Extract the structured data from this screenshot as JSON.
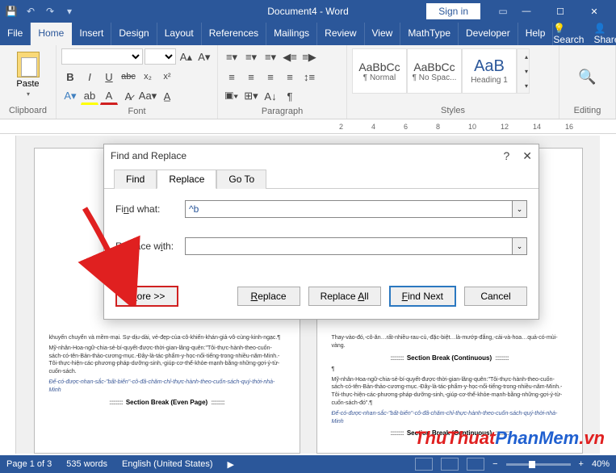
{
  "titlebar": {
    "doc_title": "Document4 - Word",
    "signin": "Sign in"
  },
  "tabs": {
    "file": "File",
    "home": "Home",
    "insert": "Insert",
    "design": "Design",
    "layout": "Layout",
    "references": "References",
    "mailings": "Mailings",
    "review": "Review",
    "view": "View",
    "mathtype": "MathType",
    "developer": "Developer",
    "help": "Help",
    "search": "Search",
    "share": "Share"
  },
  "ribbon": {
    "clipboard": {
      "paste": "Paste",
      "label": "Clipboard"
    },
    "font": {
      "label": "Font",
      "bold": "B",
      "italic": "I",
      "underline": "U",
      "strike": "abc",
      "sub": "x₂",
      "sup": "x²"
    },
    "paragraph": {
      "label": "Paragraph"
    },
    "styles": {
      "label": "Styles",
      "items": [
        {
          "preview": "AaBbCc",
          "name": "¶ Normal"
        },
        {
          "preview": "AaBbCc",
          "name": "¶ No Spac..."
        },
        {
          "preview": "AaB",
          "name": "Heading 1"
        }
      ]
    },
    "editing": {
      "label": "Editing"
    }
  },
  "ruler": {
    "marks": [
      "2",
      "4",
      "6",
      "8",
      "10",
      "12",
      "14",
      "16"
    ]
  },
  "dialog": {
    "title": "Find and Replace",
    "tabs": {
      "find": "Find",
      "replace": "Replace",
      "goto": "Go To"
    },
    "find_label": "Find what:",
    "find_value": "^b",
    "replace_label": "Replace with:",
    "replace_value": "",
    "buttons": {
      "more": "More >>",
      "replace": "Replace",
      "replace_all": "Replace All",
      "find_next": "Find Next",
      "cancel": "Cancel"
    }
  },
  "document": {
    "page1": {
      "line1": "khuyến chuyển và mềm-mại. Sự-dịu-dài, vẻ-đẹp-của-cô-khiến-khán-giả-vô-cùng-kinh-ngạc.¶",
      "line2": "Mỹ-nhân-Hoa-ngữ-chia-sẻ-bí-quyết-được-thời-gian-lãng-quên:\"Tôi-thực-hành-theo-cuốn-sách-có-tên-Bản-thảo-cương-mục.-Đây-là-tác-phẩm-y-học-nổi-tiếng-trong-nhiều-năm-Minh.-Tôi-thực-hiện-các-phương-pháp-dưỡng-sinh,-giúp-cơ-thể-khỏe-mạnh-bằng-những-gợi-ý-từ-cuốn-sách.",
      "line3": "Để-có-được-nhan-sắc-\"bất-biến\"-cô-đã-chăm-chỉ-thực-hành-theo-cuốn-sách-quý-thời-nhà-Minh",
      "break1": "Section Break (Even Page)"
    },
    "page2": {
      "line1": "Thay-vào-đó,-cô-ăn…rất-nhiều-rau-củ,-đặc-biệt…là-mướp-đắng,-cải-và-hoa…quả-có-mùi-vàng.",
      "break1": "Section Break (Continuous)",
      "paranum": "¶",
      "line2": "Mỹ-nhân-Hoa-ngữ-chia-sẻ-bí-quyết-được-thời-gian-lãng-quên:\"Tôi-thực-hành-theo-cuốn-sách-có-tên-Bản-thảo-cương-mục.-Đây-là-tác-phẩm-y-học-nổi-tiếng-trong-nhiều-năm-Minh.-Tôi-thực-hiện-các-phương-pháp-dưỡng-sinh,-giúp-cơ-thể-khỏe-mạnh-bằng-những-gợi-ý-từ-cuốn-sách-đó\".¶",
      "line3": "Để-có-được-nhan-sắc-\"bất-biến\"-cô-đã-chăm-chỉ-thực-hành-theo-cuốn-sách-quý-thời-nhà-Minh",
      "break2": "Section Break (Continuous)"
    }
  },
  "watermark": {
    "part1": "ThuThuat",
    "part2": "PhanMem",
    "part3": ".vn"
  },
  "statusbar": {
    "page": "Page 1 of 3",
    "words": "535 words",
    "lang": "English (United States)",
    "zoom": "40%"
  }
}
